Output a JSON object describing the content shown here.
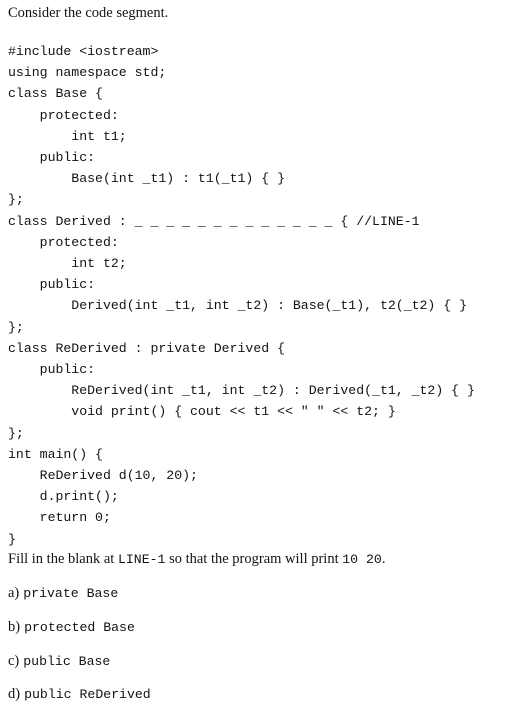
{
  "document": {
    "intro": "Consider the code segment.",
    "code": "#include <iostream>\nusing namespace std;\nclass Base {\n    protected:\n        int t1;\n    public:\n        Base(int _t1) : t1(_t1) { }\n};\nclass Derived : _ _ _ _ _ _ _ _ _ _ _ _ _ { //LINE-1\n    protected:\n        int t2;\n    public:\n        Derived(int _t1, int _t2) : Base(_t1), t2(_t2) { }\n};\nclass ReDerived : private Derived {\n    public:\n        ReDerived(int _t1, int _t2) : Derived(_t1, _t2) { }\n        void print() { cout << t1 << \" \" << t2; }\n};\nint main() {\n    ReDerived d(10, 20);\n    d.print();\n    return 0;\n}",
    "question": {
      "part1": "Fill in the blank at ",
      "line_marker": "LINE-1",
      "part2": " so that the program will print ",
      "expected_output": "10  20",
      "part3": "."
    },
    "options": [
      {
        "label": "a)",
        "text": "private Base"
      },
      {
        "label": "b)",
        "text": "protected Base"
      },
      {
        "label": "c)",
        "text": "public Base"
      },
      {
        "label": "d)",
        "text": "public ReDerived"
      }
    ]
  }
}
